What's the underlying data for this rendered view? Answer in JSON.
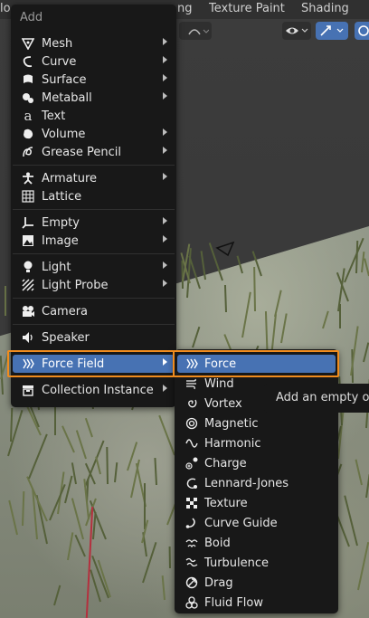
{
  "header": {
    "tabs": [
      {
        "label": "lo"
      },
      {
        "label": "ng"
      },
      {
        "label": "Texture Paint"
      },
      {
        "label": "Shading"
      }
    ]
  },
  "add_menu": {
    "title": "Add",
    "items": [
      {
        "label": "Mesh",
        "icon": "mesh-icon",
        "submenu": true
      },
      {
        "label": "Curve",
        "icon": "curve-icon",
        "submenu": true
      },
      {
        "label": "Surface",
        "icon": "surface-icon",
        "submenu": true
      },
      {
        "label": "Metaball",
        "icon": "metaball-icon",
        "submenu": true
      },
      {
        "label": "Text",
        "icon": "text-icon",
        "submenu": false
      },
      {
        "label": "Volume",
        "icon": "volume-icon",
        "submenu": true
      },
      {
        "label": "Grease Pencil",
        "icon": "grease-pencil-icon",
        "submenu": true
      },
      {
        "label": "Armature",
        "icon": "armature-icon",
        "submenu": true
      },
      {
        "label": "Lattice",
        "icon": "lattice-icon",
        "submenu": false
      },
      {
        "label": "Empty",
        "icon": "empty-icon",
        "submenu": true
      },
      {
        "label": "Image",
        "icon": "image-icon",
        "submenu": true
      },
      {
        "label": "Light",
        "icon": "light-icon",
        "submenu": true
      },
      {
        "label": "Light Probe",
        "icon": "light-probe-icon",
        "submenu": true
      },
      {
        "label": "Camera",
        "icon": "camera-icon",
        "submenu": false
      },
      {
        "label": "Speaker",
        "icon": "speaker-icon",
        "submenu": false
      },
      {
        "label": "Force Field",
        "icon": "force-field-icon",
        "submenu": true
      },
      {
        "label": "Collection Instance",
        "icon": "collection-icon",
        "submenu": true
      }
    ]
  },
  "force_field_menu": {
    "items": [
      {
        "label": "Force",
        "icon": "force-icon"
      },
      {
        "label": "Wind",
        "icon": "wind-icon"
      },
      {
        "label": "Vortex",
        "icon": "vortex-icon"
      },
      {
        "label": "Magnetic",
        "icon": "magnetic-icon"
      },
      {
        "label": "Harmonic",
        "icon": "harmonic-icon"
      },
      {
        "label": "Charge",
        "icon": "charge-icon"
      },
      {
        "label": "Lennard-Jones",
        "icon": "lennard-jones-icon"
      },
      {
        "label": "Texture",
        "icon": "texture-icon"
      },
      {
        "label": "Curve Guide",
        "icon": "curve-guide-icon"
      },
      {
        "label": "Boid",
        "icon": "boid-icon"
      },
      {
        "label": "Turbulence",
        "icon": "turbulence-icon"
      },
      {
        "label": "Drag",
        "icon": "drag-icon"
      },
      {
        "label": "Fluid Flow",
        "icon": "fluid-flow-icon"
      }
    ]
  },
  "tooltip": {
    "text": "Add an empty ob"
  },
  "colors": {
    "highlight": "#4772b3",
    "outline": "#f08c1e",
    "menu_bg": "#181818"
  }
}
